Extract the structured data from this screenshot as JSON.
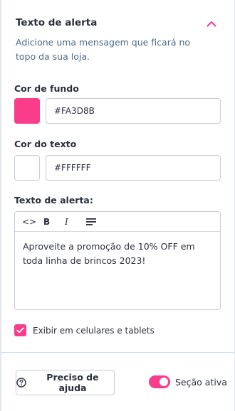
{
  "section": {
    "title": "Texto de alerta",
    "description": "Adicione uma mensagem que ficará no topo da sua loja."
  },
  "background_color": {
    "label": "Cor de fundo",
    "value": "#FA3D8B",
    "swatch": "#FA3D8B"
  },
  "text_color": {
    "label": "Cor do texto",
    "value": "#FFFFFF",
    "swatch": "#FFFFFF"
  },
  "alert_text": {
    "label": "Texto de alerta:",
    "toolbar": [
      "code-icon",
      "bold-icon",
      "italic-icon",
      "align-icon"
    ],
    "toolbar_labels": {
      "code": "<>",
      "bold": "B",
      "italic": "I"
    },
    "content": "Aproveite a promoção de 10% OFF em toda linha de brincos 2023!"
  },
  "mobile_checkbox": {
    "label": "Exibir em celulares e tablets",
    "checked": true
  },
  "footer": {
    "help_label": "Preciso de ajuda",
    "active_label": "Seção ativa",
    "active": true
  },
  "colors": {
    "accent": "#FA3D8B",
    "text": "#2b2f3a",
    "muted": "#4b6a86"
  }
}
